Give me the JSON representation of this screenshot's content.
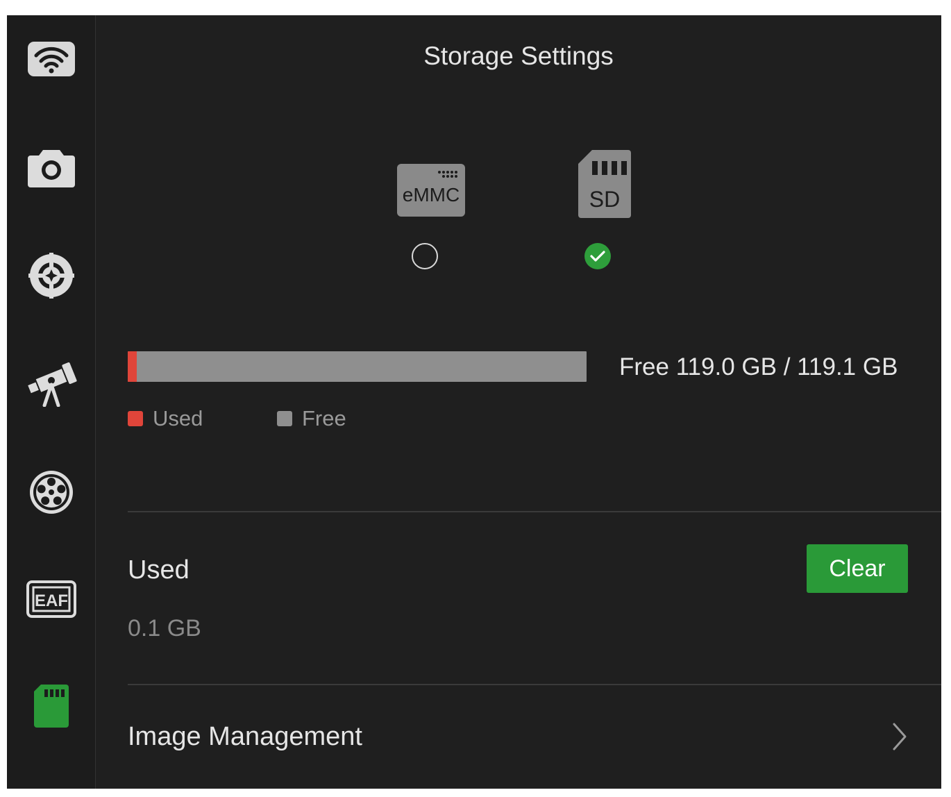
{
  "sidebar": {
    "items": [
      {
        "icon": "wifi-icon",
        "active": false
      },
      {
        "icon": "camera-icon",
        "active": false
      },
      {
        "icon": "crosshair-icon",
        "active": false
      },
      {
        "icon": "telescope-icon",
        "active": false
      },
      {
        "icon": "filter-wheel-icon",
        "active": false
      },
      {
        "icon": "eaf-focuser-icon",
        "label": "EAF",
        "active": false
      },
      {
        "icon": "sd-card-icon",
        "active": true
      }
    ]
  },
  "header": {
    "title": "Storage Settings"
  },
  "storage_options": [
    {
      "name": "emmc",
      "label": "eMMC",
      "selected": false
    },
    {
      "name": "sd",
      "label": "SD",
      "selected": true
    }
  ],
  "usage": {
    "used_fraction": 0.0008,
    "summary": "Free 119.0 GB / 119.1 GB",
    "legend_used": "Used",
    "legend_free": "Free"
  },
  "used_section": {
    "label": "Used",
    "value": "0.1 GB",
    "clear_label": "Clear"
  },
  "image_management": {
    "label": "Image Management"
  },
  "colors": {
    "accent_green": "#2a9a38",
    "used_red": "#e0453a",
    "free_gray": "#8f8f8f",
    "background": "#1f1f1f"
  }
}
